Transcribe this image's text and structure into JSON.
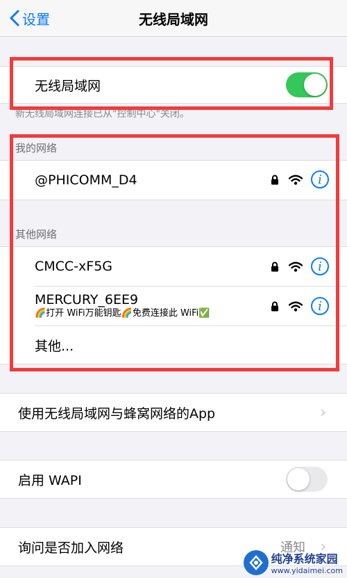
{
  "nav": {
    "back_label": "设置",
    "title": "无线局域网"
  },
  "wifi_toggle": {
    "label": "无线局域网",
    "on": true
  },
  "wifi_note": "新无线局域网连接已从\"控制中心\"关闭。",
  "my_networks": {
    "header": "我的网络",
    "items": [
      {
        "name": "@PHICOMM_D4"
      }
    ]
  },
  "other_networks": {
    "header": "其他网络",
    "items": [
      {
        "name": "CMCC-xF5G"
      },
      {
        "name": "MERCURY_6EE9",
        "subtitle": "🌈打开 WiFi万能钥匙🌈免费连接此 WiFi✅"
      }
    ],
    "other_label": "其他..."
  },
  "apps_row": {
    "label": "使用无线局域网与蜂窝网络的App"
  },
  "wapi_row": {
    "label": "启用 WAPI",
    "on": false
  },
  "ask_row": {
    "label": "询问是否加入网络",
    "value": "通知"
  },
  "watermark": {
    "title": "纯净系统家园",
    "url": "www.yidaimei.com"
  },
  "colors": {
    "accent": "#0a7aff",
    "toggle_on": "#34c759",
    "highlight": "#f23b3b"
  },
  "icons": [
    "chevron-left-icon",
    "lock-icon",
    "wifi-icon",
    "info-icon",
    "chevron-right-icon"
  ]
}
